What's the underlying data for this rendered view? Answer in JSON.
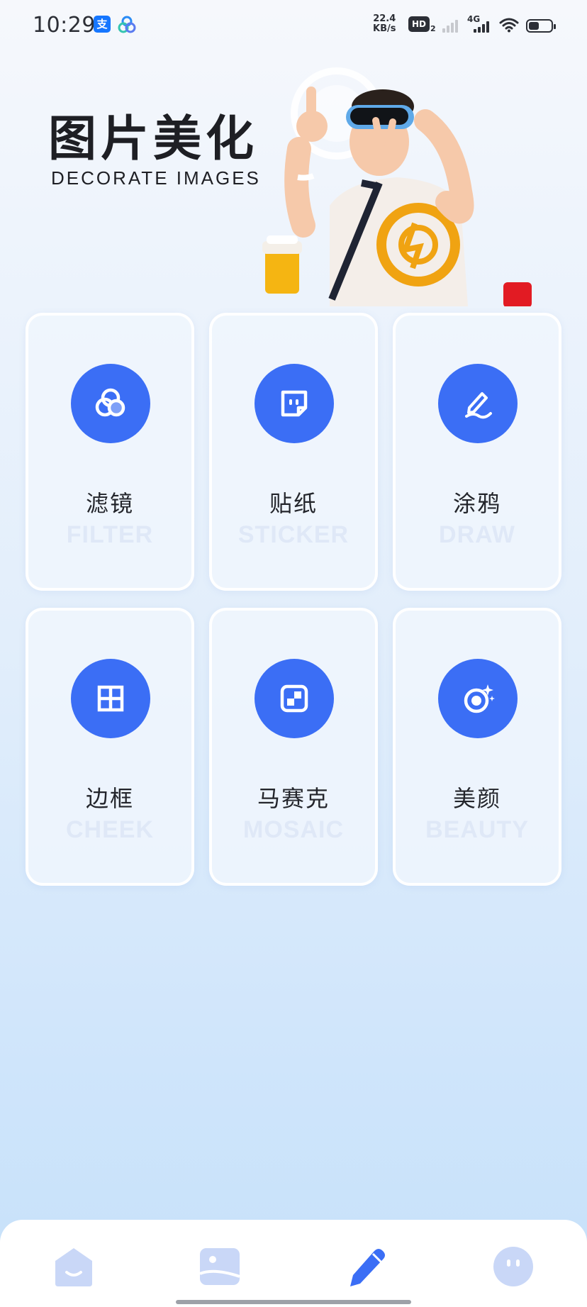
{
  "status_bar": {
    "time": "10:29",
    "alipay_glyph": "支",
    "speed_value": "22.4",
    "speed_unit": "KB/s",
    "hd_label": "HD",
    "hd_sub": "2",
    "network": "4G",
    "battery_level": 0.45
  },
  "header": {
    "title": "图片美化",
    "subtitle": "DECORATE IMAGES"
  },
  "tools": [
    {
      "label": "滤镜",
      "en": "FILTER",
      "icon": "filter-icon"
    },
    {
      "label": "贴纸",
      "en": "STICKER",
      "icon": "sticker-icon"
    },
    {
      "label": "涂鸦",
      "en": "DRAW",
      "icon": "draw-icon"
    },
    {
      "label": "边框",
      "en": "CHEEK",
      "icon": "frame-icon"
    },
    {
      "label": "马赛克",
      "en": "MOSAIC",
      "icon": "mosaic-icon"
    },
    {
      "label": "美颜",
      "en": "BEAUTY",
      "icon": "beauty-icon"
    }
  ],
  "bottom_nav": {
    "items": [
      "home-icon",
      "gallery-icon",
      "edit-icon",
      "profile-icon"
    ],
    "active_index": 2
  },
  "colors": {
    "accent": "#3b6ef5",
    "nav_inactive": "#c9d7f7",
    "nav_active": "#3b6ef5"
  }
}
